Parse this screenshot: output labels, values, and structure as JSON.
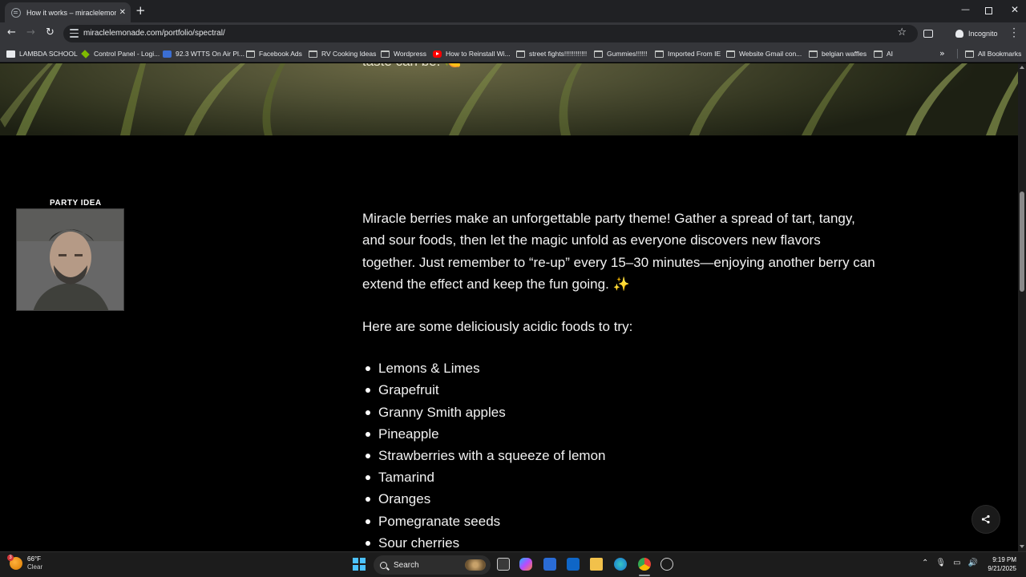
{
  "browser": {
    "tab_title": "How it works – miraclelemonade",
    "url": "miraclelemonade.com/portfolio/spectral/",
    "incognito_label": "Incognito",
    "bookmarks": [
      {
        "label": "LAMBDA SCHOOL",
        "icon": "lambda-icon"
      },
      {
        "label": "Control Panel - Logi...",
        "icon": "control-panel-icon"
      },
      {
        "label": "92.3 WTTS On Air Pl...",
        "icon": "radio-icon"
      },
      {
        "label": "Facebook Ads",
        "icon": "folder-icon"
      },
      {
        "label": "RV Cooking Ideas",
        "icon": "folder-icon"
      },
      {
        "label": "Wordpress",
        "icon": "folder-icon"
      },
      {
        "label": "How to Reinstall Wi...",
        "icon": "youtube-icon"
      },
      {
        "label": "street fights!!!!!!!!!!!!",
        "icon": "folder-icon"
      },
      {
        "label": "Gummies!!!!!!",
        "icon": "folder-icon"
      },
      {
        "label": "Imported From IE",
        "icon": "folder-icon"
      },
      {
        "label": "Website Gmail con...",
        "icon": "folder-icon"
      },
      {
        "label": "belgian waffles",
        "icon": "folder-icon"
      },
      {
        "label": "AI",
        "icon": "folder-icon"
      }
    ],
    "all_bookmarks_label": "All Bookmarks"
  },
  "page": {
    "hero_text": "taste can be. 🍋",
    "party_label": "PARTY IDEA",
    "paragraph": "Miracle berries make an unforgettable party theme! Gather a spread of tart, tangy, and sour foods, then let the magic unfold as everyone discovers new flavors together. Just remember to “re-up” every 15–30 minutes—enjoying another berry can extend the effect and keep the fun going. ✨",
    "intro": "Here are some deliciously acidic foods to try:",
    "foods": [
      "Lemons & Limes",
      "Grapefruit",
      "Granny Smith apples",
      "Pineapple",
      "Strawberries with a squeeze of lemon",
      "Tamarind",
      "Oranges",
      "Pomegranate seeds",
      "Sour cherries"
    ]
  },
  "taskbar": {
    "weather_temp": "66°F",
    "weather_cond": "Clear",
    "weather_badge": "3",
    "search_label": "Search",
    "time": "9:19 PM",
    "date": "9/21/2025"
  },
  "colors": {
    "page_bg": "#000000",
    "text": "#f2f2f2",
    "browser_frame": "#202124",
    "toolbar": "#35363a",
    "windows_accent": "#4cc2ff"
  }
}
